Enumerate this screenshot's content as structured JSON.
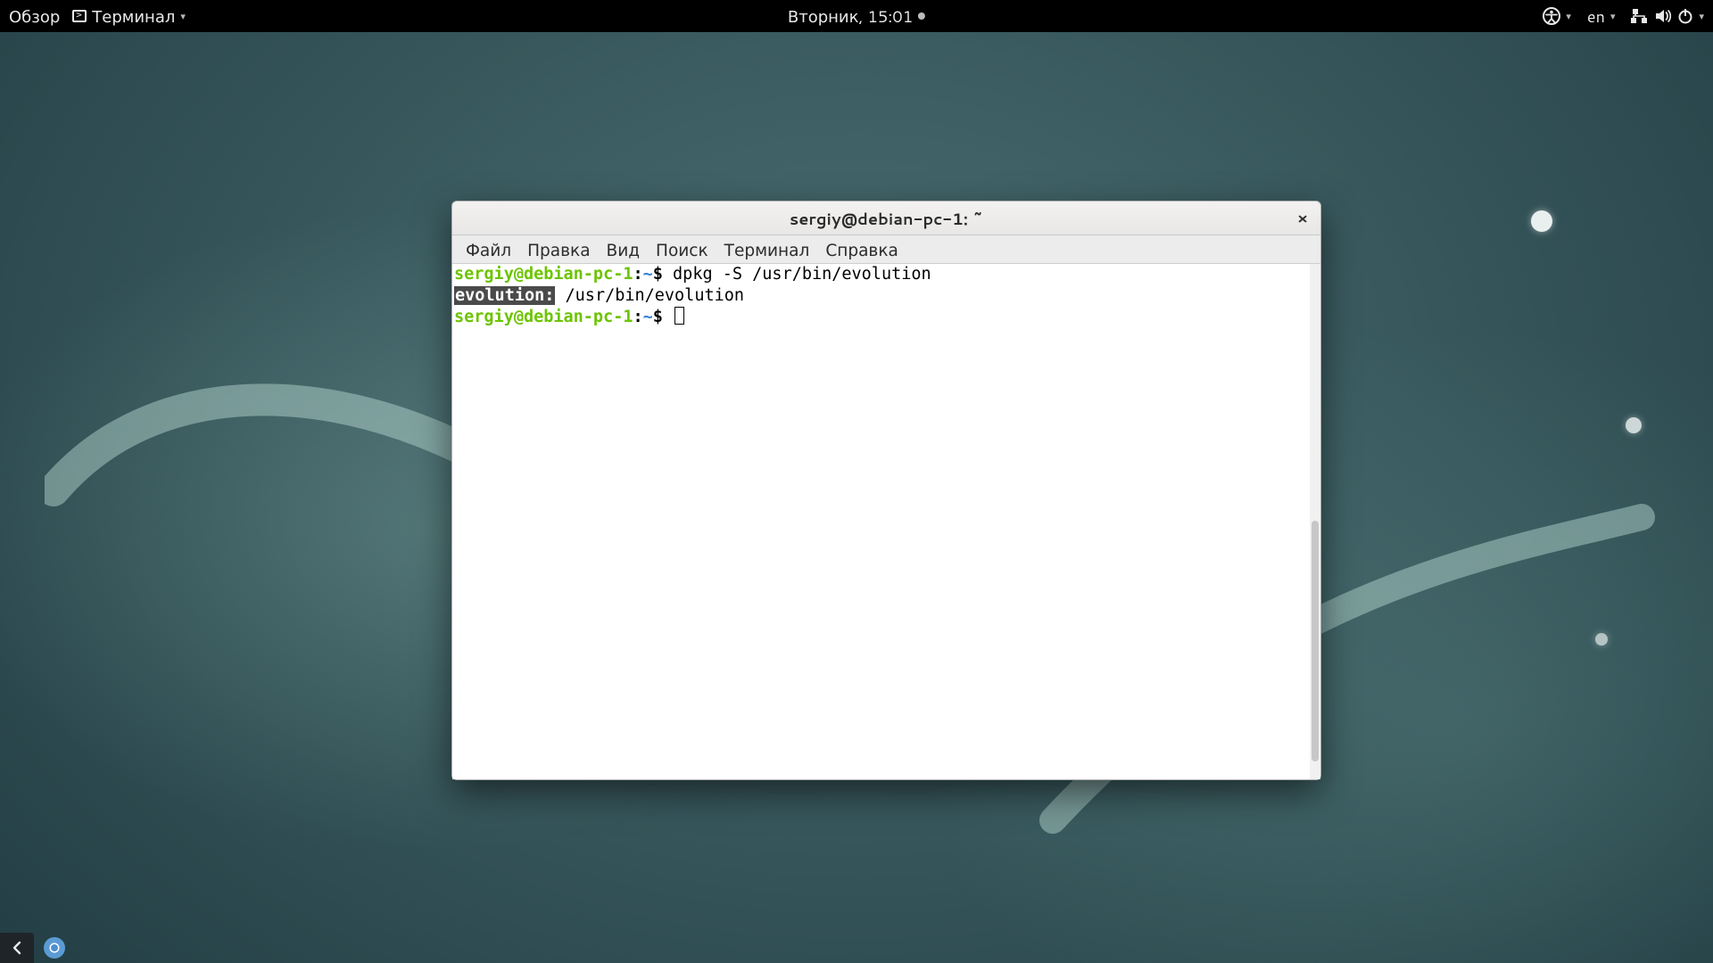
{
  "topbar": {
    "activities": "Обзор",
    "app_label": "Терминал",
    "clock": "Вторник, 15:01",
    "lang": "en"
  },
  "window": {
    "title": "sergiy@debian-pc-1: ~",
    "menus": {
      "file": "Файл",
      "edit": "Правка",
      "view": "Вид",
      "search": "Поиск",
      "terminal": "Терминал",
      "help": "Справка"
    }
  },
  "terminal": {
    "prompt_user": "sergiy@debian-pc-1",
    "prompt_sep": ":",
    "prompt_path": "~",
    "prompt_sigil": "$",
    "line1_cmd": "dpkg -S /usr/bin/evolution",
    "line2_match": "evolution:",
    "line2_rest": " /usr/bin/evolution"
  }
}
